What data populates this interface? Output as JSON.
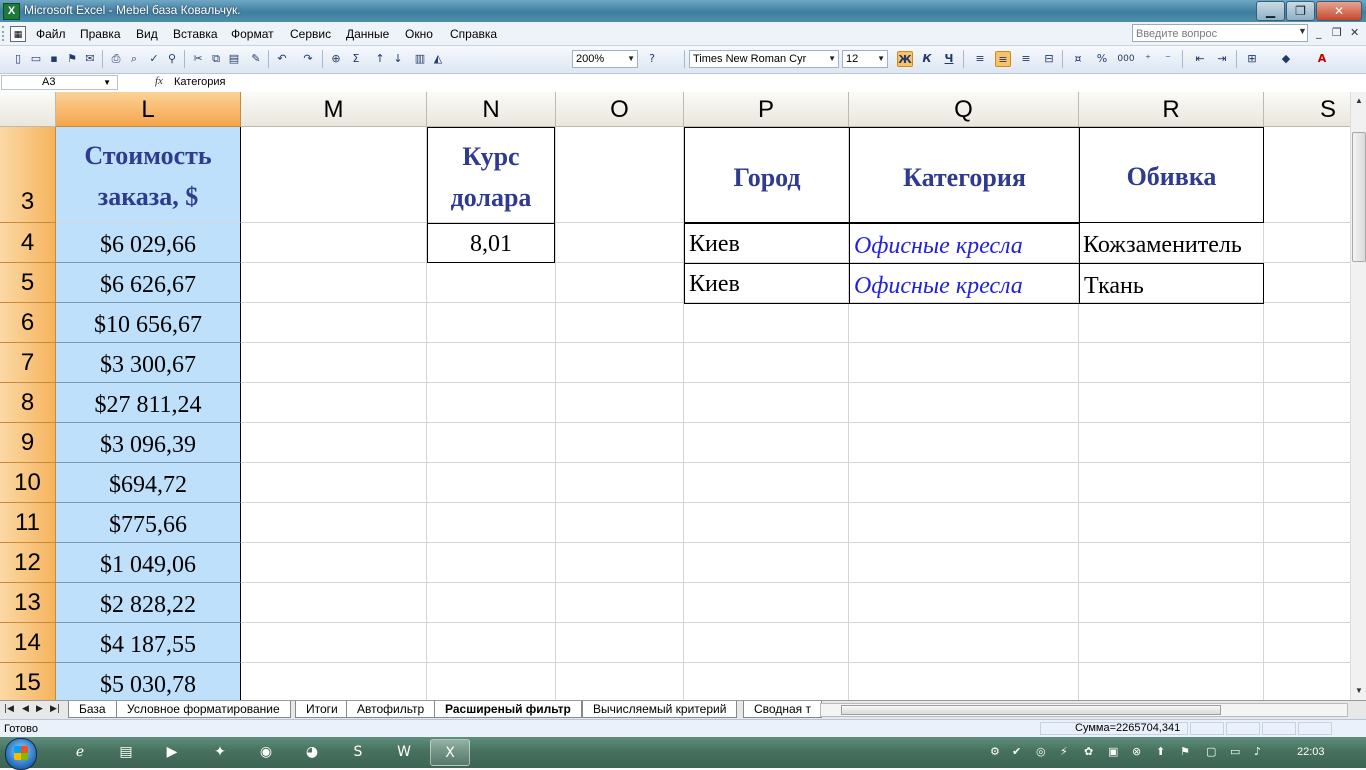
{
  "window": {
    "title": "Microsoft Excel - Mebel база Ковальчук.",
    "minimize": "▁",
    "restore": "❐",
    "close": "✕"
  },
  "menu": {
    "items": [
      "Файл",
      "Правка",
      "Вид",
      "Вставка",
      "Формат",
      "Сервис",
      "Данные",
      "Окно",
      "Справка"
    ],
    "help_placeholder": "Введите вопрос"
  },
  "toolbar": {
    "zoom": "200%",
    "font_name": "Times New Roman Cyr",
    "font_size": "12",
    "bold": "Ж",
    "italic": "К",
    "underline": "Ч",
    "percent": "%",
    "thousands": "000",
    "sigma": "Σ"
  },
  "formula_bar": {
    "name_box": "A3",
    "fx": "fx",
    "content": "Категория"
  },
  "columns": [
    "L",
    "M",
    "N",
    "O",
    "P",
    "Q",
    "R",
    "S"
  ],
  "rows": [
    "3",
    "4",
    "5",
    "6",
    "7",
    "8",
    "9",
    "10",
    "11",
    "12",
    "13",
    "14",
    "15"
  ],
  "cells": {
    "L3_line1": "Стоимость",
    "L3_line2": "заказа, $",
    "L_values": [
      "$6 029,66",
      "$6 626,67",
      "$10 656,67",
      "$3 300,67",
      "$27 811,24",
      "$3 096,39",
      "$694,72",
      "$775,66",
      "$1 049,06",
      "$2 828,22",
      "$4 187,55",
      "$5 030,78"
    ],
    "N3_line1": "Курс",
    "N3_line2": "долара",
    "N4": "8,01",
    "P3": "Город",
    "Q3": "Категория",
    "R3": "Обивка",
    "criteria": [
      {
        "city": "Киев",
        "category": "Офисные кресла",
        "upholstery": "Кожзаменитель"
      },
      {
        "city": "Киев",
        "category": "Офисные кресла",
        "upholstery": "Ткань"
      }
    ]
  },
  "sheet_tabs": [
    "База",
    "Условное форматирование",
    "Итоги",
    "Автофильтр",
    "Расширеный фильтр",
    "Вычисляемый критерий",
    "Сводная т"
  ],
  "active_tab": "Расширеный фильтр",
  "status": {
    "ready": "Готово",
    "sum": "Сумма=2265704,341"
  },
  "taskbar": {
    "clock": "22:03"
  },
  "colors": {
    "title_text": "#2e3b8f",
    "selected_col": "#bfe0fb",
    "header_orange": "#f6b35d",
    "category_text": "#2222dd"
  }
}
